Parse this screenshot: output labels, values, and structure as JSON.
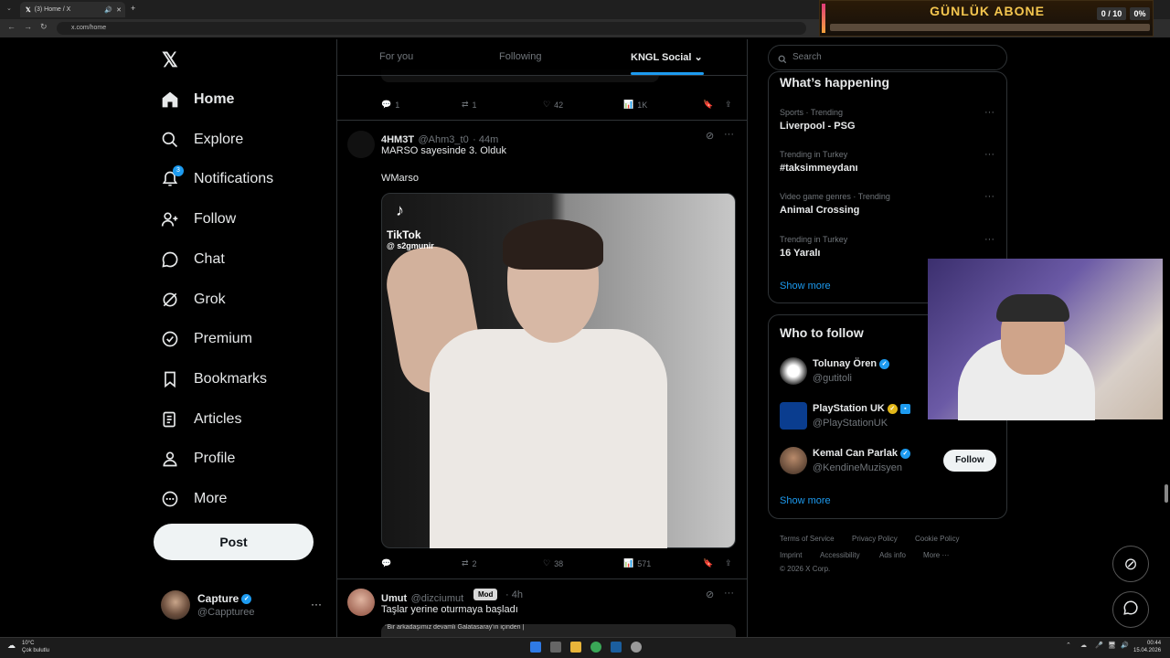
{
  "browser": {
    "tab_title": "(3) Home / X",
    "url": "x.com/home"
  },
  "overlay": {
    "title": "GÜNLÜK ABONE",
    "count": "0 / 10",
    "percent": "0%",
    "progress": 0
  },
  "nav": {
    "home": "Home",
    "explore": "Explore",
    "notifications": "Notifications",
    "notifications_badge": "3",
    "follow": "Follow",
    "chat": "Chat",
    "grok": "Grok",
    "premium": "Premium",
    "bookmarks": "Bookmarks",
    "articles": "Articles",
    "profile": "Profile",
    "more": "More",
    "post": "Post"
  },
  "account": {
    "name": "Capture",
    "handle": "@Cappturee",
    "more": "···"
  },
  "feed_tabs": {
    "for_you": "For you",
    "following": "Following",
    "kngl": "KNGL Social"
  },
  "prev_tweet_actions": {
    "replies": "1",
    "reposts": "1",
    "likes": "42",
    "views": "1K"
  },
  "tweet1": {
    "name": "4HM3T",
    "handle": "@Ahm3_t0",
    "time": "· 44m",
    "text": "MARSO sayesinde 3. Olduk",
    "text2": "WMarso",
    "media": {
      "brand": "TikTok",
      "user": "@ s2gmunir"
    },
    "replies": "",
    "reposts": "2",
    "likes": "38",
    "views": "571"
  },
  "tweet2": {
    "name": "Umut",
    "handle": "@dizciumut",
    "badge": "Mod",
    "time": "· 4h",
    "text": "Taşlar yerine oturmaya başladı",
    "preview": "\"Bir arkadaşımız devamlı Galatasaray'ın içinden |"
  },
  "right": {
    "search_placeholder": "Search",
    "happening_title": "What’s happening",
    "trends": [
      {
        "meta": "Sports · Trending",
        "name": "Liverpool - PSG"
      },
      {
        "meta": "Trending in Turkey",
        "name": "#taksimmeydanı"
      },
      {
        "meta": "Video game genres · Trending",
        "name": "Animal Crossing"
      },
      {
        "meta": "Trending in Turkey",
        "name": "16 Yaralı"
      }
    ],
    "show_more": "Show more",
    "wtf_title": "Who to follow",
    "follows": [
      {
        "name": "Tolunay Ören",
        "handle": "@gutitoli"
      },
      {
        "name": "PlayStation UK",
        "handle": "@PlayStationUK"
      },
      {
        "name": "Kemal Can Parlak",
        "handle": "@KendineMuzisyen"
      }
    ],
    "follow_label": "Follow",
    "show_more2": "Show more",
    "footer": {
      "terms": "Terms of Service",
      "privacy": "Privacy Policy",
      "cookie": "Cookie Policy",
      "imprint": "Imprint",
      "accessibility": "Accessibility",
      "ads": "Ads info",
      "more": "More ···",
      "copyright": "© 2026 X Corp."
    }
  },
  "taskbar": {
    "temp": "10°C",
    "weather": "Çok bulutlu",
    "time": "00:44",
    "date": "15.04.2026"
  },
  "colors": {
    "accent": "#1d9bf0",
    "overlay_title": "#f4c64f"
  }
}
